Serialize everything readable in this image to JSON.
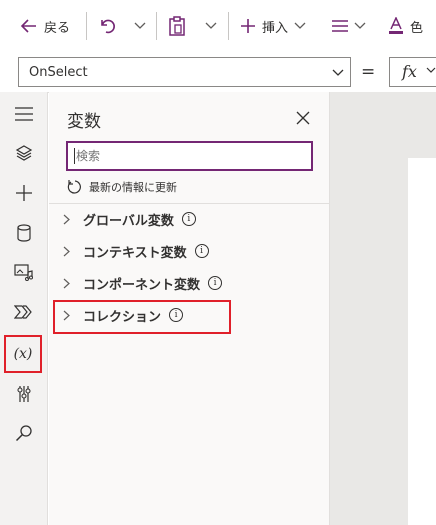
{
  "toolbar": {
    "back_label": "戻る",
    "insert_label": "挿入",
    "color_label": "色"
  },
  "formula_bar": {
    "property": "OnSelect",
    "equals": "=",
    "fx": "fx"
  },
  "rail": {
    "icons": [
      "hamburger-icon",
      "layers-icon",
      "plus-icon",
      "database-icon",
      "media-icon",
      "automate-icon",
      "variables-icon",
      "tools-icon",
      "search-icon"
    ],
    "selected": "variables-icon",
    "variables_glyph": "(x)"
  },
  "panel": {
    "title": "変数",
    "search_placeholder": "検索",
    "refresh_label": "最新の情報に更新",
    "sections": [
      {
        "label": "グローバル変数"
      },
      {
        "label": "コンテキスト変数"
      },
      {
        "label": "コンポーネント変数"
      },
      {
        "label": "コレクション"
      }
    ],
    "highlighted_section": "コレクション"
  },
  "colors": {
    "accent": "#742774",
    "highlight": "#e0202a",
    "rail_bg": "#f3f2f1",
    "canvas_bg": "#e9e8e6"
  }
}
